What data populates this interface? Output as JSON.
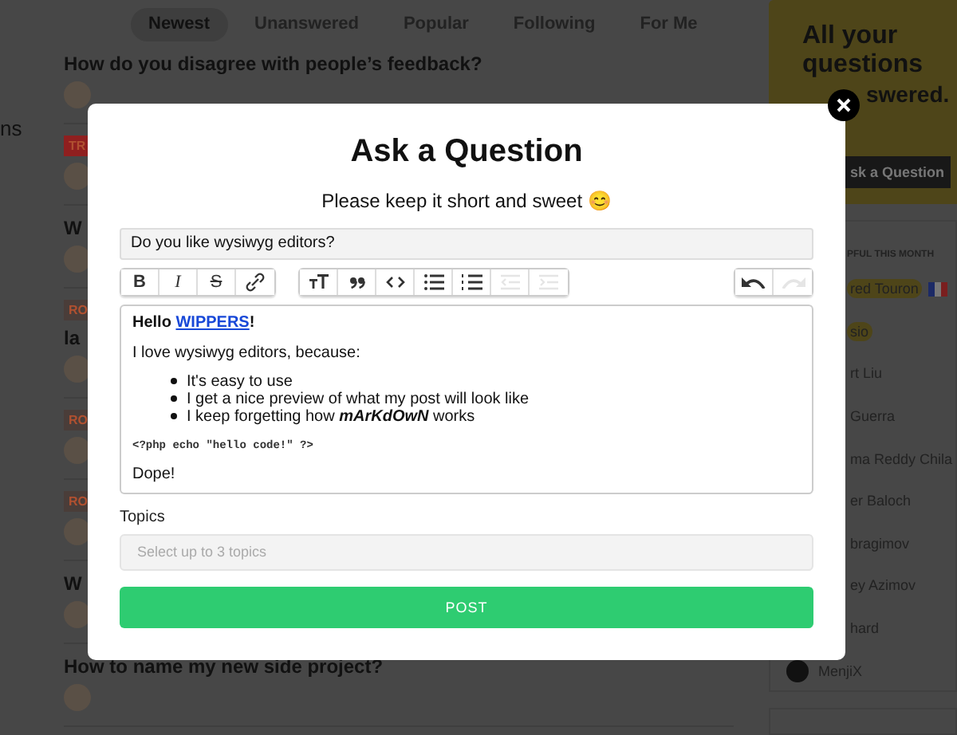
{
  "background": {
    "sidebar_fragment": "ns",
    "tabs": [
      {
        "label": "Newest",
        "selected": true
      },
      {
        "label": "Unanswered",
        "selected": false
      },
      {
        "label": "Popular",
        "selected": false
      },
      {
        "label": "Following",
        "selected": false
      },
      {
        "label": "For Me",
        "selected": false
      }
    ],
    "questions": [
      {
        "title": "How do you disagree with people’s feedback?"
      },
      {
        "tag": "TR",
        "color": "#8f1f1f"
      },
      {
        "title": "W"
      },
      {
        "tag": "RO",
        "color": "#4a3d39",
        "title": "la"
      },
      {
        "tag": "RO",
        "color": "#4a3d39"
      },
      {
        "tag": "RO",
        "color": "#4a3d39"
      },
      {
        "title": "W"
      },
      {
        "title": "How to name my new side project?"
      }
    ],
    "promo": {
      "lines": [
        "All your",
        "questions"
      ],
      "cut_line": "swered.",
      "button": "sk a Question"
    },
    "helpful": {
      "heading": "PFUL THIS MONTH",
      "people": [
        {
          "kind": "cut",
          "name": "red Touron",
          "highlighted": true,
          "flag": true
        },
        {
          "kind": "cut",
          "name": "sio",
          "highlighted": true,
          "flag": false
        },
        {
          "kind": "cut",
          "name": "rt Liu",
          "highlighted": false,
          "flag": false
        },
        {
          "kind": "cut",
          "name": "Guerra",
          "highlighted": false,
          "flag": false
        },
        {
          "kind": "cut",
          "name": "ma Reddy Chila",
          "highlighted": false,
          "flag": false
        },
        {
          "kind": "cut",
          "name": "er Baloch",
          "highlighted": false,
          "flag": false
        },
        {
          "kind": "cut",
          "name": "bragimov",
          "highlighted": false,
          "flag": false
        },
        {
          "kind": "cut",
          "name": "ey Azimov",
          "highlighted": false,
          "flag": false
        },
        {
          "kind": "cut",
          "name": "hard",
          "highlighted": false,
          "flag": false
        },
        {
          "kind": "full",
          "name": "MenjiX",
          "highlighted": false,
          "flag": false
        }
      ]
    }
  },
  "modal": {
    "title": "Ask a Question",
    "subtitle": "Please keep it short and sweet 😊",
    "question": {
      "value": "Do you like wysiwyg editors?"
    },
    "toolbar": {
      "groups": [
        {
          "buttons": [
            {
              "kind": "bold",
              "label": "B",
              "disabled": false
            },
            {
              "kind": "italic",
              "label": "I",
              "disabled": false
            },
            {
              "kind": "strike",
              "label": "S",
              "disabled": false
            },
            {
              "kind": "link",
              "disabled": false
            }
          ]
        },
        {
          "buttons": [
            {
              "kind": "heading",
              "disabled": false
            },
            {
              "kind": "quote",
              "disabled": false
            },
            {
              "kind": "code",
              "disabled": false
            },
            {
              "kind": "bullets",
              "disabled": false
            },
            {
              "kind": "numbers",
              "disabled": false
            },
            {
              "kind": "outdent",
              "disabled": true
            },
            {
              "kind": "indent",
              "disabled": true
            }
          ]
        },
        {
          "buttons": [
            {
              "kind": "undo",
              "disabled": false
            },
            {
              "kind": "redo",
              "disabled": true
            }
          ]
        }
      ]
    },
    "editor": {
      "greeting": {
        "text": "Hello",
        "link": "WIPPERS",
        "after": "!"
      },
      "intro": "I love wysiwyg editors, because:",
      "bullets": [
        "It's easy to use",
        "I get a nice preview of what my post will look like",
        "I keep forgetting how *mArKdOwN* works"
      ],
      "code": "<?php echo \"hello code!\" ?>",
      "closing": "Dope!"
    },
    "topics": {
      "label": "Topics",
      "placeholder": "Select up to 3 topics"
    },
    "submit": "POST"
  }
}
